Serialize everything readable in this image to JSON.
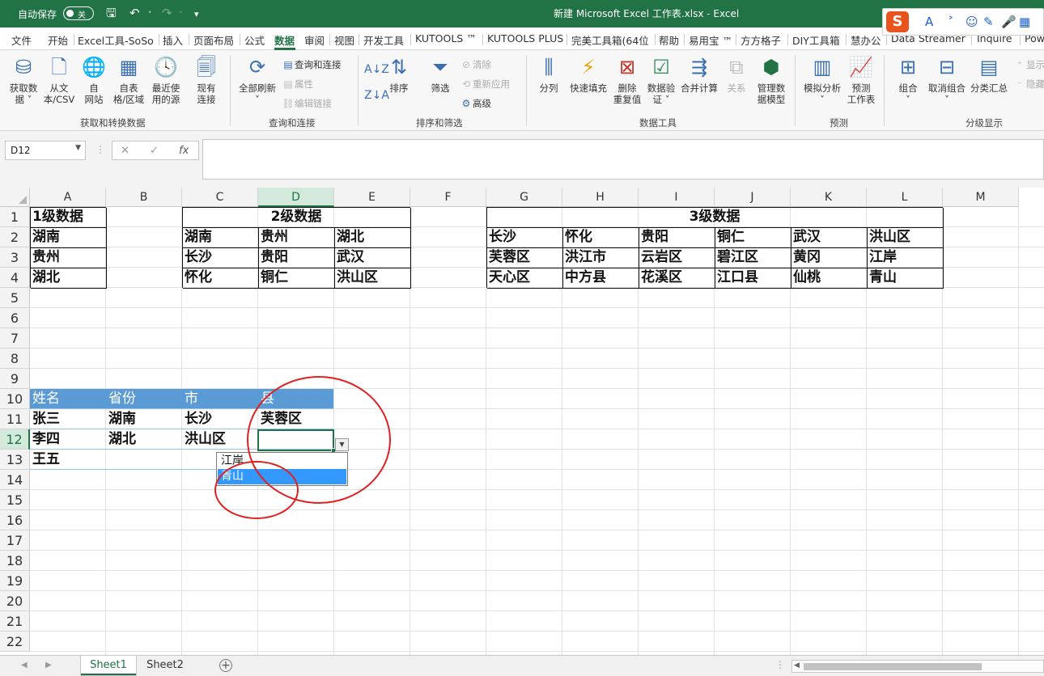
{
  "titlebar": {
    "autosave_label": "自动保存",
    "autosave_state": "关",
    "document_title": "新建 Microsoft Excel 工作表.xlsx  -  Excel"
  },
  "ime": {
    "logo": "S",
    "items": [
      "A",
      "˃",
      "☺",
      "✎",
      "🎤",
      "▦"
    ]
  },
  "menu": {
    "items": [
      "文件",
      "开始",
      "Excel工具-SoSo",
      "插入",
      "页面布局",
      "公式",
      "数据",
      "审阅",
      "视图",
      "开发工具",
      "KUTOOLS ™",
      "KUTOOLS PLUS",
      "完美工具箱(64位",
      "帮助",
      "易用宝 ™",
      "方方格子",
      "DIY工具箱",
      "慧办公",
      "Data Streamer",
      "Inquire",
      "Pow"
    ],
    "active": "数据"
  },
  "ribbon": {
    "groups": {
      "get": "获取和转换数据",
      "query": "查询和连接",
      "sort": "排序和筛选",
      "tools": "数据工具",
      "forecast": "预测",
      "outline": "分级显示"
    },
    "buttons": {
      "get_data": [
        "获取数",
        "据 ˅"
      ],
      "from_csv": [
        "从文",
        "本/CSV"
      ],
      "from_web": [
        "自",
        "网站"
      ],
      "from_table": [
        "自表",
        "格/区域"
      ],
      "recent": [
        "最近使",
        "用的源"
      ],
      "existing": [
        "现有",
        "连接"
      ],
      "refresh_all": [
        "全部刷新",
        "˅"
      ],
      "sort": "排序",
      "filter": "筛选",
      "text_to_columns": "分列",
      "flash_fill": "快速填充",
      "remove_dup": [
        "删除",
        "重复值"
      ],
      "validation": [
        "数据验",
        "证 ˅"
      ],
      "consolidate": "合并计算",
      "relations": "关系",
      "data_model": [
        "管理数",
        "据模型"
      ],
      "what_if": [
        "模拟分析",
        "˅"
      ],
      "forecast_sheet": [
        "预测",
        "工作表"
      ],
      "group": [
        "组合",
        "˅"
      ],
      "ungroup": [
        "取消组合",
        "˅"
      ],
      "subtotal": "分类汇总"
    },
    "small": {
      "queries": "查询和连接",
      "properties": "属性",
      "edit_links": "编辑链接",
      "clear": "清除",
      "reapply": "重新应用",
      "advanced": "高级",
      "show_detail": "显示",
      "hide_detail": "隐藏"
    }
  },
  "formula_bar": {
    "name_box": "D12",
    "formula": ""
  },
  "columns": [
    "A",
    "B",
    "C",
    "D",
    "E",
    "F",
    "G",
    "H",
    "I",
    "J",
    "K",
    "L",
    "M"
  ],
  "selected_column": "D",
  "rows": [
    "1",
    "2",
    "3",
    "4",
    "5",
    "6",
    "7",
    "8",
    "9",
    "10",
    "11",
    "12",
    "13",
    "14",
    "15",
    "16",
    "17",
    "18",
    "19",
    "20",
    "21",
    "22"
  ],
  "selected_row": "12",
  "sheet": {
    "level1": {
      "title": "1级数据",
      "items": [
        "湖南",
        "贵州",
        "湖北"
      ]
    },
    "level2": {
      "title": "2级数据",
      "rows": [
        [
          "湖南",
          "贵州",
          "湖北"
        ],
        [
          "长沙",
          "贵阳",
          "武汉"
        ],
        [
          "怀化",
          "铜仁",
          "洪山区"
        ]
      ]
    },
    "level3": {
      "title": "3级数据",
      "rows": [
        [
          "长沙",
          "怀化",
          "贵阳",
          "铜仁",
          "武汉",
          "洪山区"
        ],
        [
          "芙蓉区",
          "洪江市",
          "云岩区",
          "碧江区",
          "黄冈",
          "江岸"
        ],
        [
          "天心区",
          "中方县",
          "花溪区",
          "江口县",
          "仙桃",
          "青山"
        ]
      ]
    },
    "table": {
      "headers": [
        "姓名",
        "省份",
        "市",
        "县"
      ],
      "rows": [
        [
          "张三",
          "湖南",
          "长沙",
          "芙蓉区"
        ],
        [
          "李四",
          "湖北",
          "洪山区",
          ""
        ],
        [
          "王五",
          "",
          "",
          ""
        ]
      ]
    }
  },
  "dropdown": {
    "options": [
      "江岸",
      "青山"
    ],
    "highlighted": "青山"
  },
  "tabs": {
    "sheets": [
      "Sheet1",
      "Sheet2"
    ],
    "active": "Sheet1",
    "add": "+"
  },
  "colors": {
    "excel_green": "#217346",
    "table_header": "#5b9bd5",
    "highlight": "#3399ff",
    "annotation": "#e02020"
  }
}
